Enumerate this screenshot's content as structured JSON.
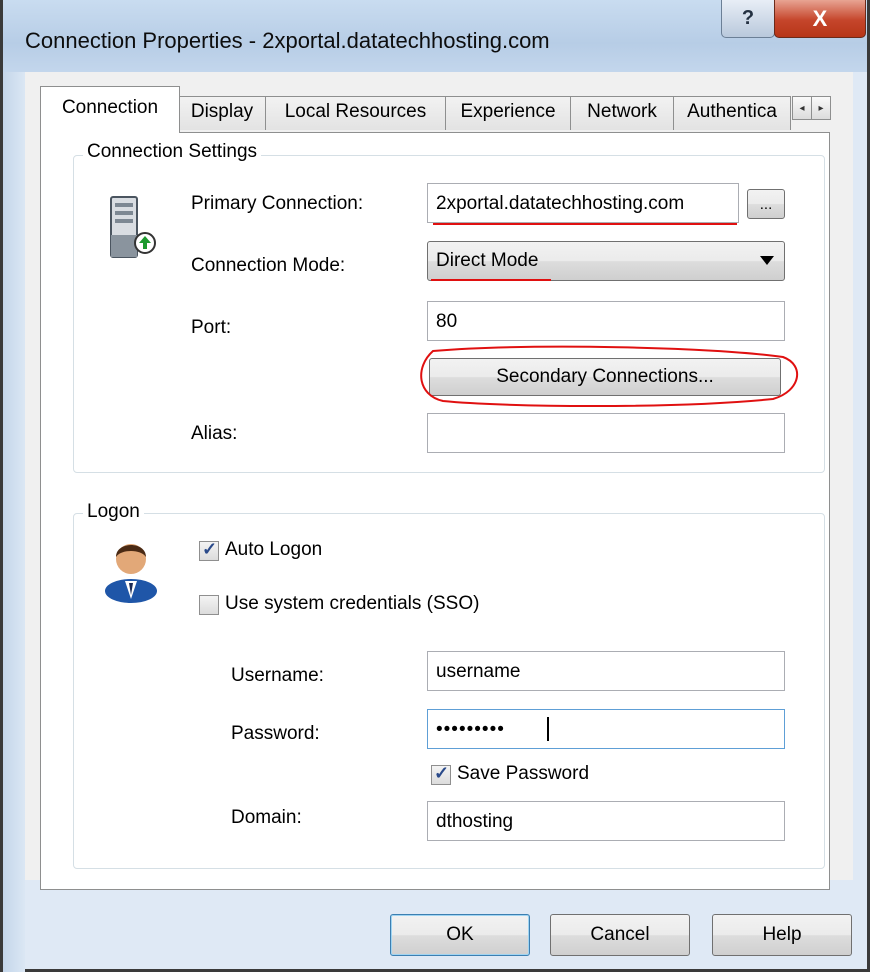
{
  "window": {
    "title": "Connection Properties - 2xportal.datatechhosting.com",
    "help_glyph": "?",
    "close_glyph": "X"
  },
  "tabs": [
    {
      "label": "Connection",
      "active": true
    },
    {
      "label": "Display",
      "active": false
    },
    {
      "label": "Local Resources",
      "active": false
    },
    {
      "label": "Experience",
      "active": false
    },
    {
      "label": "Network",
      "active": false
    },
    {
      "label": "Authentica",
      "active": false
    }
  ],
  "tab_scroll": {
    "left": "◂",
    "right": "▸"
  },
  "connection_settings": {
    "group_title": "Connection Settings",
    "primary_label": "Primary Connection:",
    "primary_value": "2xportal.datatechhosting.com",
    "browse_label": "...",
    "mode_label": "Connection Mode:",
    "mode_value": "Direct Mode",
    "port_label": "Port:",
    "port_value": "80",
    "secondary_button": "Secondary Connections...",
    "alias_label": "Alias:",
    "alias_value": "",
    "icon": "server-icon"
  },
  "logon": {
    "group_title": "Logon",
    "icon": "user-icon",
    "auto_logon_label": "Auto Logon",
    "auto_logon_checked": true,
    "sso_label": "Use system credentials (SSO)",
    "sso_checked": false,
    "username_label": "Username:",
    "username_value": "username",
    "password_label": "Password:",
    "password_value": "•••••••••",
    "save_password_label": "Save Password",
    "save_password_checked": true,
    "domain_label": "Domain:",
    "domain_value": "dthosting"
  },
  "footer": {
    "ok": "OK",
    "cancel": "Cancel",
    "help": "Help"
  },
  "colors": {
    "annotation_red": "#e01010",
    "checkmark": "#2a4a8a",
    "frame": "#dfe9f5"
  }
}
